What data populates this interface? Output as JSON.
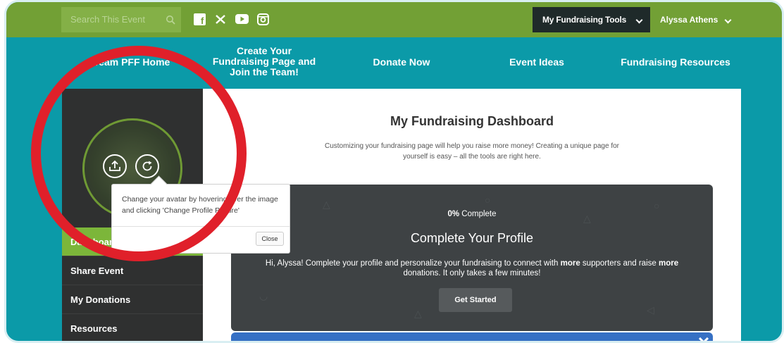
{
  "colors": {
    "topbar": "#72a035",
    "teal": "#0b9aa8",
    "accent_green": "#7cb63a",
    "annotation_red": "#e0202a"
  },
  "search": {
    "placeholder": "Search This Event",
    "icon": "search-icon"
  },
  "social": [
    {
      "name": "facebook-icon",
      "glyph": "f"
    },
    {
      "name": "x-icon",
      "glyph": "X"
    },
    {
      "name": "youtube-icon",
      "glyph": "▶"
    },
    {
      "name": "instagram-icon",
      "glyph": "◘"
    }
  ],
  "header": {
    "tools_label": "My Fundraising Tools",
    "user_label": "Alyssa Athens"
  },
  "nav": {
    "home": "Team PFF Home",
    "create": "Create Your Fundraising Page and Join the Team!",
    "donate": "Donate Now",
    "ideas": "Event Ideas",
    "resources": "Fundraising Resources"
  },
  "tooltip": {
    "text": "Change your avatar by hovering over the image and clicking 'Change Profile Picture'",
    "close_label": "Close"
  },
  "sidebar": {
    "items": [
      {
        "label": "Dashboard",
        "active": true
      },
      {
        "label": "Share Event",
        "active": false
      },
      {
        "label": "My Donations",
        "active": false
      },
      {
        "label": "Resources",
        "active": false
      }
    ]
  },
  "main": {
    "title": "My Fundraising Dashboard",
    "subtitle": "Customizing your fundraising page will help you raise more money! Creating a unique page for yourself is easy – all the tools are right here."
  },
  "profile_card": {
    "percent": "0%",
    "percent_label": " Complete",
    "title": "Complete Your Profile",
    "text_1": "Hi, Alyssa! Complete your profile and personalize your fundraising to connect with ",
    "bold_1": "more",
    "text_2": " supporters and raise ",
    "bold_2": "more",
    "text_3": " donations. It only takes a few minutes!",
    "button_label": "Get Started"
  }
}
